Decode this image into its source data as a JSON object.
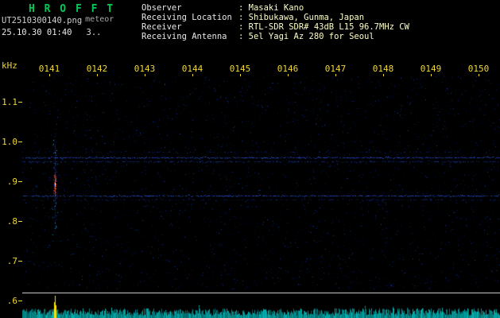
{
  "app": {
    "title": "H R O F F T"
  },
  "header": {
    "filename": "UT2510300140.png",
    "tag": "meteor",
    "datetime": "25.10.30 01:40",
    "counter": "3..",
    "info": [
      {
        "label": "Observer",
        "value": ": Masaki Kano"
      },
      {
        "label": "Receiving Location",
        "value": ": Shibukawa, Gunma, Japan"
      },
      {
        "label": "Receiver",
        "value": ": RTL-SDR SDR# 43dB L15 96.7MHz CW"
      },
      {
        "label": "Receiving Antenna",
        "value": ": 5el Yagi Az 280 for Seoul"
      }
    ]
  },
  "chart_data": {
    "type": "heatmap",
    "title": "",
    "x_axis": {
      "labels": [
        "0141",
        "0142",
        "0143",
        "0144",
        "0145",
        "0146",
        "0147",
        "0148",
        "0149",
        "0150"
      ],
      "unit": "UT hhmm"
    },
    "y_axis": {
      "label": "kHz",
      "ticks": [
        "1.1",
        "1.0",
        ".9",
        ".8",
        ".7",
        ".6"
      ],
      "range": [
        0.6,
        1.1
      ]
    },
    "features": {
      "carrier_lines_khz": [
        0.96,
        0.95,
        0.87,
        0.86
      ],
      "meteor_echo": {
        "time": "0141",
        "freq_khz_center": 0.89,
        "freq_span_khz": [
          0.77,
          1.03
        ]
      },
      "signal_level_strip": "noise floor band with yellow spike at meteor echo time"
    },
    "colors": {
      "axis": "#f0d830",
      "noise": [
        "#000a40",
        "#001a66",
        "#03298c",
        "#0b3cb4"
      ],
      "carrier_strong": "#2a55e0",
      "carrier_mid": "#1a3cb0",
      "carrier_faint": "#14288a",
      "echo_glow": "#2244ff",
      "echo_white": "#ffffff",
      "echo_yellow": "#ffe000",
      "echo_orange": "#ff8800",
      "echo_red": "#ff2a00",
      "echo_magenta": "#ff44cc",
      "echo_cyan": "#00ccff",
      "strip": "#00b4b4",
      "strip_bright": "#00e8e8",
      "spike": "#ffe000"
    }
  }
}
